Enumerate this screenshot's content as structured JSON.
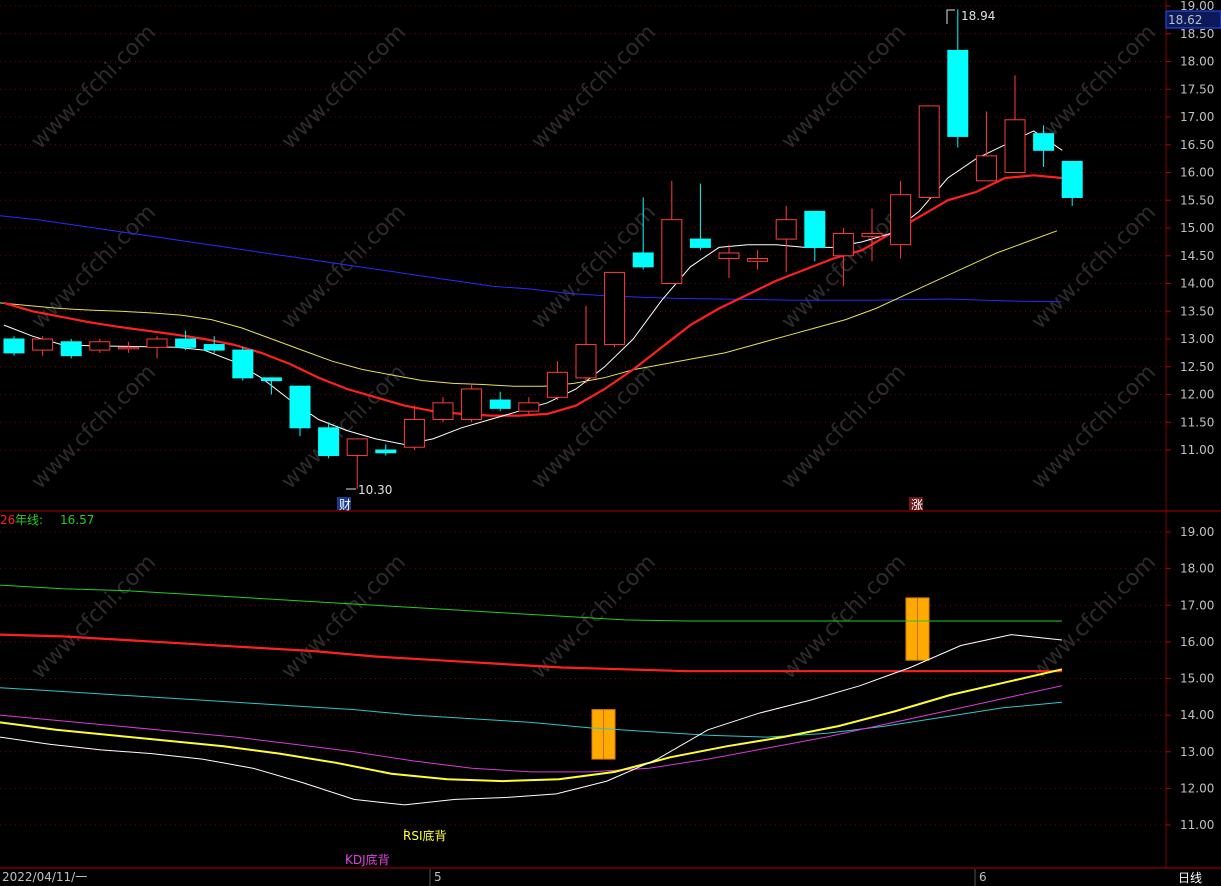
{
  "watermark": "www.cfchi.com",
  "top_panel": {
    "price_badge": "18.62",
    "high_label": "18.94",
    "low_label": "10.30",
    "markers": [
      "财",
      "涨"
    ],
    "y_ticks": [
      "19.00",
      "18.50",
      "18.00",
      "17.50",
      "17.00",
      "16.50",
      "16.00",
      "15.50",
      "15.00",
      "14.50",
      "14.00",
      "13.50",
      "13.00",
      "12.50",
      "12.00",
      "11.50",
      "11.00"
    ]
  },
  "bottom_panel": {
    "legend_prefix": "26",
    "legend_label": "年线:",
    "legend_value": "16.57",
    "signal_rsi": "RSI底背",
    "signal_kdj": "KDJ底背",
    "y_ticks": [
      "19.00",
      "18.00",
      "17.00",
      "16.00",
      "15.00",
      "14.00",
      "13.00",
      "12.00",
      "11.00"
    ]
  },
  "bottom_bar": {
    "date_label": "2022/04/11/一",
    "month_5": "5",
    "month_6": "6",
    "period": "日线"
  },
  "colors": {
    "up": "#ff3b3b",
    "down": "#00ffff",
    "ma5": "#ffffff",
    "ma10": "#ff2020",
    "ma20": "#e6e05a",
    "ma60": "#2a2aff",
    "green": "#22cc22",
    "cyan_line": "#2fc6c6",
    "magenta": "#d83ad8",
    "yellow": "#ffff30",
    "orange": "#ffaa00",
    "grid": "#7a0000"
  },
  "chart_data": [
    {
      "type": "candlestick",
      "ylim": [
        10.0,
        19.0
      ],
      "candles": [
        [
          13.0,
          12.75,
          13.05,
          12.7
        ],
        [
          12.8,
          13.0,
          13.05,
          12.7
        ],
        [
          12.95,
          12.7,
          13.0,
          12.65
        ],
        [
          12.8,
          12.95,
          13.0,
          12.75
        ],
        [
          12.85,
          12.85,
          12.95,
          12.75
        ],
        [
          12.85,
          13.0,
          13.05,
          12.65
        ],
        [
          13.0,
          12.85,
          13.15,
          12.8
        ],
        [
          12.9,
          12.8,
          13.05,
          12.75
        ],
        [
          12.8,
          12.3,
          12.85,
          12.25
        ],
        [
          12.3,
          12.25,
          12.3,
          12.0
        ],
        [
          12.15,
          11.4,
          12.15,
          11.25
        ],
        [
          11.4,
          10.9,
          11.5,
          10.85
        ],
        [
          10.9,
          11.2,
          11.2,
          10.3
        ],
        [
          11.0,
          10.95,
          11.1,
          10.9
        ],
        [
          11.05,
          11.55,
          11.8,
          11.0
        ],
        [
          11.55,
          11.85,
          11.95,
          11.5
        ],
        [
          11.55,
          12.1,
          12.2,
          11.5
        ],
        [
          11.9,
          11.75,
          12.05,
          11.7
        ],
        [
          11.7,
          11.85,
          11.95,
          11.65
        ],
        [
          11.95,
          12.4,
          12.6,
          11.9
        ],
        [
          12.3,
          12.9,
          13.6,
          12.2
        ],
        [
          12.9,
          14.2,
          14.2,
          12.85
        ],
        [
          14.55,
          14.3,
          15.55,
          14.25
        ],
        [
          14.0,
          15.15,
          15.85,
          14.0
        ],
        [
          14.8,
          14.65,
          15.8,
          14.6
        ],
        [
          14.45,
          14.55,
          14.7,
          14.1
        ],
        [
          14.4,
          14.45,
          14.6,
          14.25
        ],
        [
          14.8,
          15.15,
          15.4,
          14.2
        ],
        [
          15.3,
          14.65,
          15.3,
          14.4
        ],
        [
          14.5,
          14.9,
          15.0,
          13.95
        ],
        [
          14.85,
          14.9,
          15.35,
          14.4
        ],
        [
          14.7,
          15.6,
          15.85,
          14.45
        ],
        [
          15.55,
          17.2,
          17.2,
          15.5
        ],
        [
          18.2,
          16.65,
          18.94,
          16.45
        ],
        [
          15.85,
          16.3,
          17.1,
          15.85
        ],
        [
          16.0,
          16.95,
          17.75,
          16.0
        ],
        [
          16.7,
          16.4,
          16.85,
          16.1
        ],
        [
          16.2,
          15.55,
          16.2,
          15.4
        ]
      ],
      "ma5": [
        13.25,
        13.05,
        12.9,
        12.88,
        12.87,
        12.86,
        12.85,
        12.8,
        12.6,
        12.3,
        11.9,
        11.55,
        11.35,
        11.2,
        11.1,
        11.2,
        11.4,
        11.55,
        11.7,
        11.85,
        12.1,
        12.5,
        13.0,
        13.7,
        14.3,
        14.65,
        14.7,
        14.7,
        14.65,
        14.65,
        14.75,
        14.9,
        15.3,
        15.9,
        16.25,
        16.5,
        16.75,
        16.4
      ],
      "ma10": [
        13.65,
        13.5,
        13.4,
        13.3,
        13.22,
        13.15,
        13.08,
        13.0,
        12.9,
        12.75,
        12.55,
        12.3,
        12.1,
        11.95,
        11.8,
        11.7,
        11.65,
        11.62,
        11.62,
        11.65,
        11.8,
        12.1,
        12.45,
        12.85,
        13.25,
        13.55,
        13.8,
        14.05,
        14.25,
        14.45,
        14.6,
        14.9,
        15.2,
        15.5,
        15.65,
        15.9,
        15.95,
        15.9
      ],
      "ma20": [
        13.65,
        13.6,
        13.55,
        13.52,
        13.5,
        13.47,
        13.43,
        13.35,
        13.2,
        13.0,
        12.8,
        12.6,
        12.45,
        12.35,
        12.25,
        12.2,
        12.18,
        12.15,
        12.15,
        12.2,
        12.3,
        12.45,
        12.55,
        12.65,
        12.75,
        12.9,
        13.05,
        13.2,
        13.35,
        13.55,
        13.8,
        14.05,
        14.3,
        14.55,
        14.75,
        14.95
      ],
      "ma60": [
        15.22,
        15.15,
        15.05,
        14.95,
        14.85,
        14.75,
        14.65,
        14.55,
        14.45,
        14.35,
        14.25,
        14.15,
        14.05,
        13.95,
        13.9,
        13.82,
        13.78,
        13.75,
        13.73,
        13.72,
        13.71,
        13.7,
        13.7,
        13.7,
        13.71,
        13.72,
        13.7,
        13.68,
        13.67
      ]
    },
    {
      "type": "line",
      "ylim": [
        10.0,
        19.5
      ],
      "series": [
        {
          "name": "年线",
          "values": [
            17.55,
            17.45,
            17.4,
            17.3,
            17.2,
            17.1,
            17.0,
            16.9,
            16.8,
            16.7,
            16.6,
            16.57,
            16.57,
            16.57,
            16.57,
            16.57,
            16.57,
            16.57
          ]
        },
        {
          "values": [
            16.2,
            16.15,
            16.05,
            15.95,
            15.85,
            15.75,
            15.6,
            15.5,
            15.4,
            15.3,
            15.25,
            15.2,
            15.2,
            15.2,
            15.2,
            15.2,
            15.2,
            15.2
          ]
        },
        {
          "values": [
            14.75,
            14.65,
            14.55,
            14.45,
            14.35,
            14.25,
            14.15,
            14.0,
            13.9,
            13.8,
            13.65,
            13.55,
            13.45,
            13.4,
            13.5,
            13.7,
            13.95,
            14.2,
            14.35
          ]
        },
        {
          "values": [
            14.0,
            13.85,
            13.7,
            13.55,
            13.4,
            13.2,
            13.0,
            12.75,
            12.55,
            12.45,
            12.45,
            12.55,
            12.8,
            13.1,
            13.4,
            13.75,
            14.1,
            14.45,
            14.8
          ]
        },
        {
          "values": [
            13.8,
            13.6,
            13.45,
            13.3,
            13.15,
            12.95,
            12.7,
            12.4,
            12.25,
            12.2,
            12.25,
            12.45,
            12.85,
            13.15,
            13.4,
            13.7,
            14.1,
            14.55,
            14.9,
            15.25
          ]
        },
        {
          "values": [
            13.4,
            13.2,
            13.05,
            12.95,
            12.8,
            12.55,
            12.15,
            11.7,
            11.55,
            11.7,
            11.75,
            11.85,
            12.2,
            12.8,
            13.6,
            14.05,
            14.4,
            14.8,
            15.3,
            15.9,
            16.2,
            16.05
          ]
        }
      ],
      "signal_bars": [
        [
          12.8,
          14.15
        ],
        [
          15.5,
          17.2
        ]
      ]
    }
  ]
}
